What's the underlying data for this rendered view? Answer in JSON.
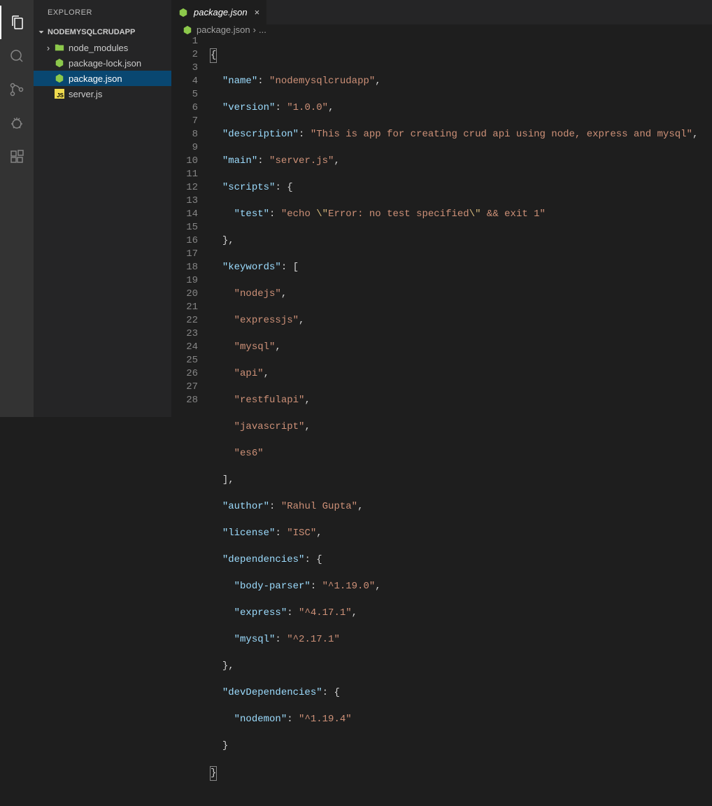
{
  "sidebar": {
    "title": "EXPLORER",
    "root": "NODEMYSQLCRUDAPP",
    "items": [
      {
        "label": "node_modules",
        "type": "folder"
      },
      {
        "label": "package-lock.json",
        "type": "node"
      },
      {
        "label": "package.json",
        "type": "node",
        "active": true
      },
      {
        "label": "server.js",
        "type": "js"
      }
    ]
  },
  "tab": {
    "label": "package.json"
  },
  "breadcrumb": {
    "file": "package.json",
    "sep": "›",
    "rest": "..."
  },
  "line_count": 28,
  "code": {
    "l1": "{",
    "l2": {
      "k": "\"name\"",
      "v": "\"nodemysqlcrudapp\""
    },
    "l3": {
      "k": "\"version\"",
      "v": "\"1.0.0\""
    },
    "l4": {
      "k": "\"description\"",
      "v": "\"This is app for creating crud api using node, express and mysql\""
    },
    "l5": {
      "k": "\"main\"",
      "v": "\"server.js\""
    },
    "l6": {
      "k": "\"scripts\""
    },
    "l7": {
      "k": "\"test\"",
      "vparts": [
        "\"echo ",
        "\\\"",
        "Error: no test specified",
        "\\\"",
        " && exit 1\""
      ]
    },
    "l8": "},",
    "l9": {
      "k": "\"keywords\""
    },
    "l10": "\"nodejs\"",
    "l11": "\"expressjs\"",
    "l12": "\"mysql\"",
    "l13": "\"api\"",
    "l14": "\"restfulapi\"",
    "l15": "\"javascript\"",
    "l16": "\"es6\"",
    "l17": "],",
    "l18": {
      "k": "\"author\"",
      "v": "\"Rahul Gupta\""
    },
    "l19": {
      "k": "\"license\"",
      "v": "\"ISC\""
    },
    "l20": {
      "k": "\"dependencies\""
    },
    "l21": {
      "k": "\"body-parser\"",
      "v": "\"^1.19.0\""
    },
    "l22": {
      "k": "\"express\"",
      "v": "\"^4.17.1\""
    },
    "l23": {
      "k": "\"mysql\"",
      "v": "\"^2.17.1\""
    },
    "l24": "},",
    "l25": {
      "k": "\"devDependencies\""
    },
    "l26": {
      "k": "\"nodemon\"",
      "v": "\"^1.19.4\""
    },
    "l27": "}",
    "l28": "}"
  }
}
